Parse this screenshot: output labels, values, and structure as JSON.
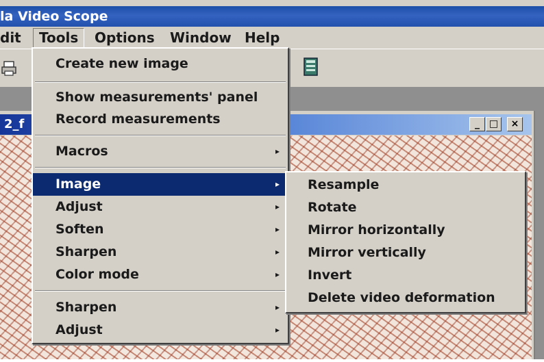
{
  "window": {
    "title": "la Video Scope"
  },
  "menubar": {
    "items": [
      {
        "label": "dit"
      },
      {
        "label": "Tools"
      },
      {
        "label": "Options"
      },
      {
        "label": "Window"
      },
      {
        "label": "Help"
      }
    ]
  },
  "toolbar": {
    "icons": [
      "print-icon",
      "document-icon"
    ]
  },
  "document": {
    "title": "2_f",
    "buttons": {
      "minimize": "_",
      "maximize": "□",
      "close": "×"
    }
  },
  "tools_menu": {
    "items": [
      {
        "label": "Create new image"
      },
      {
        "label": "Show measurements' panel"
      },
      {
        "label": "Record measurements"
      },
      {
        "label": "Macros",
        "arrow": "▸"
      },
      {
        "label": "Image",
        "arrow": "▸"
      },
      {
        "label": "Adjust",
        "arrow": "▸"
      },
      {
        "label": "Soften",
        "arrow": "▸"
      },
      {
        "label": "Sharpen",
        "arrow": "▸"
      },
      {
        "label": "Color mode",
        "arrow": "▸"
      },
      {
        "label": "Sharpen",
        "arrow": "▸"
      },
      {
        "label": "Adjust",
        "arrow": "▸"
      }
    ],
    "highlighted": "Image"
  },
  "image_submenu": {
    "items": [
      {
        "label": "Resample"
      },
      {
        "label": "Rotate"
      },
      {
        "label": "Mirror horizontally"
      },
      {
        "label": "Mirror vertically"
      },
      {
        "label": "Invert"
      },
      {
        "label": "Delete video deformation"
      }
    ]
  },
  "colors": {
    "highlight": "#0b2a6f",
    "menu_bg": "#d4d0c8",
    "title_bar": "#2150ad"
  }
}
